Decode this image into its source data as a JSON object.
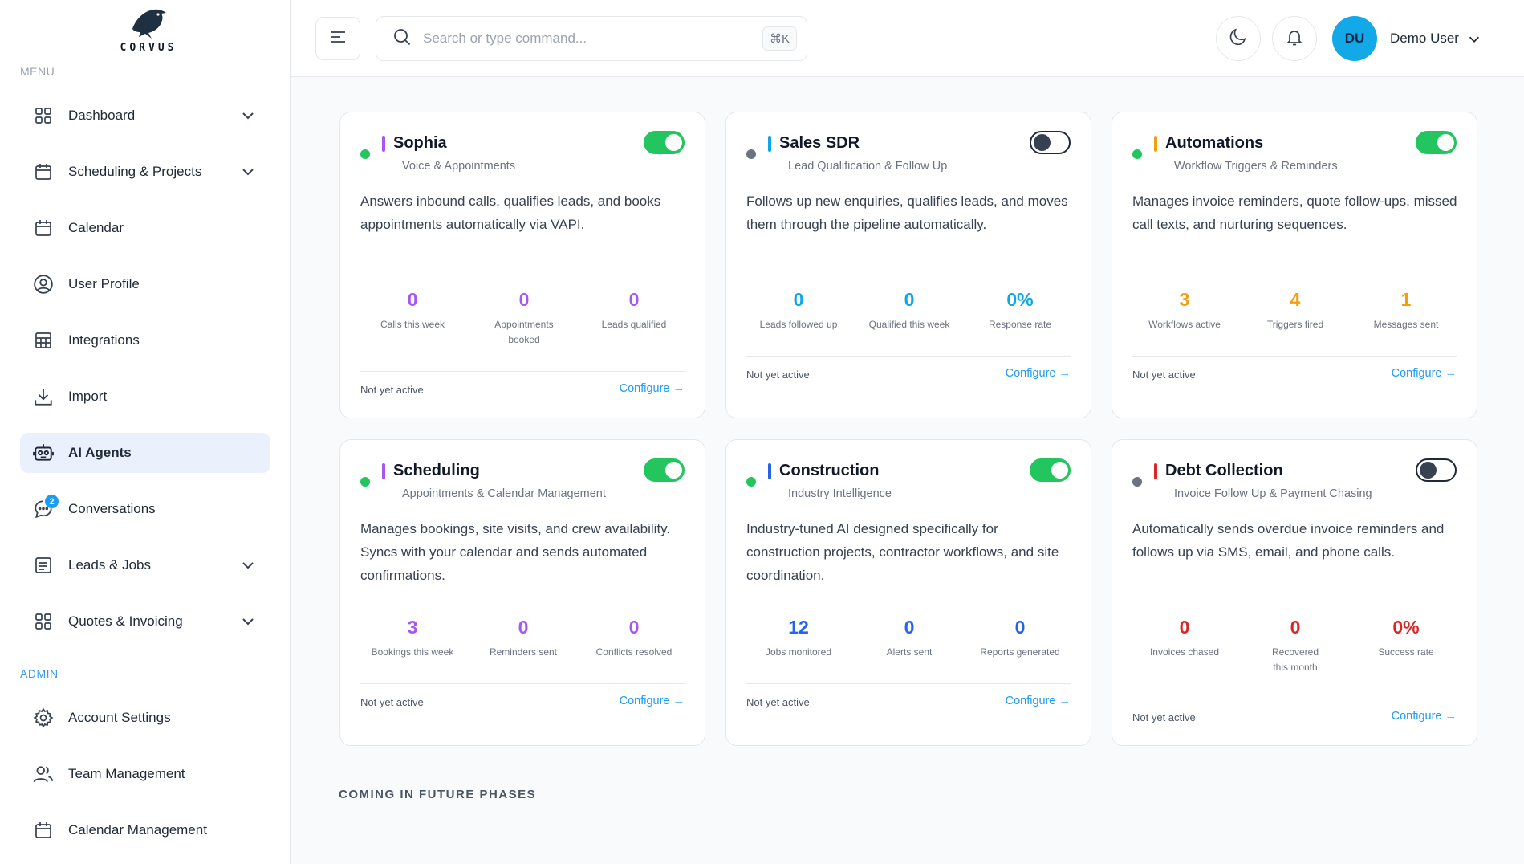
{
  "brand": {
    "name": "CORVUS"
  },
  "sidebar": {
    "menu_heading": "MENU",
    "admin_heading": "ADMIN",
    "items": [
      {
        "label": "Dashboard",
        "icon": "grid-icon",
        "has_chevron": true
      },
      {
        "label": "Scheduling & Projects",
        "icon": "calendar-icon",
        "has_chevron": true
      },
      {
        "label": "Calendar",
        "icon": "calendar-icon",
        "has_chevron": false
      },
      {
        "label": "User Profile",
        "icon": "user-circle-icon",
        "has_chevron": false
      },
      {
        "label": "Integrations",
        "icon": "table-icon",
        "has_chevron": false
      },
      {
        "label": "Import",
        "icon": "download-icon",
        "has_chevron": false
      },
      {
        "label": "AI Agents",
        "icon": "robot-icon",
        "has_chevron": false,
        "active": true
      },
      {
        "label": "Conversations",
        "icon": "chat-icon",
        "has_chevron": false,
        "badge": "2"
      },
      {
        "label": "Leads & Jobs",
        "icon": "list-icon",
        "has_chevron": true
      },
      {
        "label": "Quotes & Invoicing",
        "icon": "grid-icon",
        "has_chevron": true
      }
    ],
    "admin_items": [
      {
        "label": "Account Settings",
        "icon": "gear-icon"
      },
      {
        "label": "Team Management",
        "icon": "users-icon"
      },
      {
        "label": "Calendar Management",
        "icon": "calendar-icon"
      }
    ]
  },
  "header": {
    "search_placeholder": "Search or type command...",
    "shortcut": "⌘K",
    "avatar_initials": "DU",
    "user_name": "Demo User"
  },
  "agents": [
    {
      "name": "Sophia",
      "subtitle": "Voice & Appointments",
      "accent": "#a855f7",
      "active": true,
      "dot_color": "#22c55e",
      "description": "Answers inbound calls, qualifies leads, and books appointments automatically via VAPI.",
      "stats": [
        {
          "value": "0",
          "label": "Calls this week"
        },
        {
          "value": "0",
          "label": "Appointments booked"
        },
        {
          "value": "0",
          "label": "Leads qualified"
        }
      ],
      "status": "Not yet active",
      "action": "Configure →"
    },
    {
      "name": "Sales SDR",
      "subtitle": "Lead Qualification & Follow Up",
      "accent": "#0ea5e9",
      "active": false,
      "dot_color": "#6b7280",
      "description": "Follows up new enquiries, qualifies leads, and moves them through the pipeline automatically.",
      "stats": [
        {
          "value": "0",
          "label": "Leads followed up"
        },
        {
          "value": "0",
          "label": "Qualified this week"
        },
        {
          "value": "0%",
          "label": "Response rate"
        }
      ],
      "status": "Not yet active",
      "action": "Configure →"
    },
    {
      "name": "Automations",
      "subtitle": "Workflow Triggers & Reminders",
      "accent": "#f59e0b",
      "active": true,
      "dot_color": "#22c55e",
      "description": "Manages invoice reminders, quote follow-ups, missed call texts, and nurturing sequences.",
      "stats": [
        {
          "value": "3",
          "label": "Workflows active"
        },
        {
          "value": "4",
          "label": "Triggers fired"
        },
        {
          "value": "1",
          "label": "Messages sent"
        }
      ],
      "status": "Not yet active",
      "action": "Configure →"
    },
    {
      "name": "Scheduling",
      "subtitle": "Appointments & Calendar Management",
      "accent": "#a855f7",
      "active": true,
      "dot_color": "#22c55e",
      "description": "Manages bookings, site visits, and crew availability. Syncs with your calendar and sends automated confirmations.",
      "stats": [
        {
          "value": "3",
          "label": "Bookings this week"
        },
        {
          "value": "0",
          "label": "Reminders sent"
        },
        {
          "value": "0",
          "label": "Conflicts resolved"
        }
      ],
      "status": "Not yet active",
      "action": "Configure →"
    },
    {
      "name": "Construction",
      "subtitle": "Industry Intelligence",
      "accent": "#2563eb",
      "active": true,
      "dot_color": "#22c55e",
      "description": "Industry-tuned AI designed specifically for construction projects, contractor workflows, and site coordination.",
      "stats": [
        {
          "value": "12",
          "label": "Jobs monitored"
        },
        {
          "value": "0",
          "label": "Alerts sent"
        },
        {
          "value": "0",
          "label": "Reports generated"
        }
      ],
      "status": "Not yet active",
      "action": "Configure →"
    },
    {
      "name": "Debt Collection",
      "subtitle": "Invoice Follow Up & Payment Chasing",
      "accent": "#dc2626",
      "active": false,
      "dot_color": "#6b7280",
      "description": "Automatically sends overdue invoice reminders and follows up via SMS, email, and phone calls.",
      "stats": [
        {
          "value": "0",
          "label": "Invoices chased"
        },
        {
          "value": "0",
          "label": "Recovered this month"
        },
        {
          "value": "0%",
          "label": "Success rate"
        }
      ],
      "status": "Not yet active",
      "action": "Configure →"
    }
  ],
  "future_heading": "COMING IN FUTURE PHASES"
}
